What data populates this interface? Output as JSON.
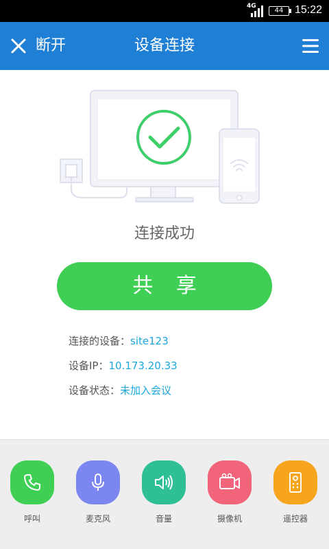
{
  "status_bar": {
    "network": "4G",
    "battery": "44",
    "time": "15:22"
  },
  "header": {
    "disconnect_label": "断开",
    "title": "设备连接"
  },
  "connection_status": "连接成功",
  "share_button_label": "共 享",
  "info": [
    {
      "label": "连接的设备：",
      "value": "site123"
    },
    {
      "label": "设备IP：",
      "value": "10.173.20.33"
    },
    {
      "label": "设备状态：",
      "value": "未加入会议"
    }
  ],
  "dock": [
    {
      "label": "呼叫",
      "icon": "phone-icon",
      "color": "#3fcf55"
    },
    {
      "label": "麦克风",
      "icon": "microphone-icon",
      "color": "#7b86f0"
    },
    {
      "label": "音量",
      "icon": "speaker-icon",
      "color": "#2fbf94"
    },
    {
      "label": "摄像机",
      "icon": "camera-icon",
      "color": "#f2647a"
    },
    {
      "label": "遥控器",
      "icon": "remote-control-icon",
      "color": "#f7a51c"
    }
  ],
  "colors": {
    "header": "#1f7fd5",
    "accent_green": "#3fcf55",
    "info_value": "#1aa7e0"
  }
}
